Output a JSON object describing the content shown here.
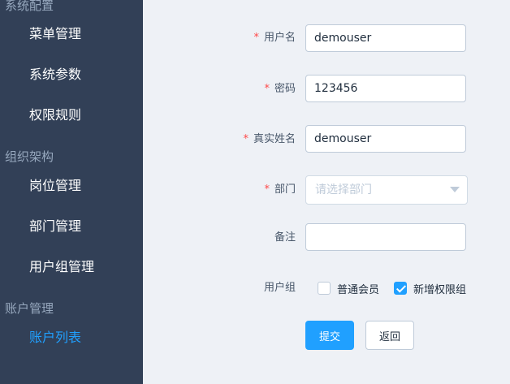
{
  "sidebar": {
    "groups": [
      {
        "title": "系统配置",
        "items": [
          {
            "label": "菜单管理"
          },
          {
            "label": "系统参数"
          },
          {
            "label": "权限规则"
          }
        ]
      },
      {
        "title": "组织架构",
        "items": [
          {
            "label": "岗位管理"
          },
          {
            "label": "部门管理"
          },
          {
            "label": "用户组管理"
          }
        ]
      },
      {
        "title": "账户管理",
        "items": [
          {
            "label": "账户列表",
            "active": true
          }
        ]
      }
    ]
  },
  "form": {
    "required_mark": "*",
    "username": {
      "label": "用户名",
      "value": "demouser"
    },
    "password": {
      "label": "密码",
      "value": "123456"
    },
    "realname": {
      "label": "真实姓名",
      "value": "demouser"
    },
    "department": {
      "label": "部门",
      "placeholder": "请选择部门"
    },
    "remark": {
      "label": "备注",
      "value": ""
    },
    "user_group": {
      "label": "用户组",
      "options": [
        {
          "label": "普通会员",
          "checked": false
        },
        {
          "label": "新增权限组",
          "checked": true
        }
      ]
    },
    "submit_label": "提交",
    "back_label": "返回"
  },
  "icons": {
    "dropdown": "chevron-down-icon",
    "checkbox_check": "check-icon"
  },
  "colors": {
    "sidebar_bg": "#324057",
    "active": "#20a0ff",
    "required": "#ff4949",
    "main_bg": "#eef1f6"
  }
}
